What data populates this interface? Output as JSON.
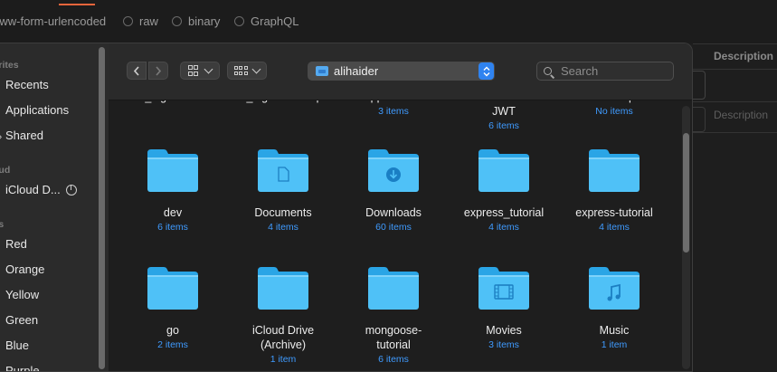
{
  "background_app": {
    "body_options": [
      {
        "label": "www-form-urlencoded",
        "radio": false
      },
      {
        "label": "raw",
        "radio": true
      },
      {
        "label": "binary",
        "radio": true
      },
      {
        "label": "GraphQL",
        "radio": true
      }
    ],
    "table_header": "Description",
    "table_placeholder": "Description",
    "accent_color": "#e8653c"
  },
  "sidebar": {
    "sections": [
      {
        "title": "orites",
        "items": [
          "Recents",
          "Applications",
          "Shared"
        ]
      },
      {
        "title": "oud",
        "items": [
          "iCloud D..."
        ]
      },
      {
        "title": "gs",
        "items": [
          "Red",
          "Orange",
          "Yellow",
          "Green",
          "Blue",
          "Purple"
        ]
      }
    ],
    "icloud_icon": "progress-circle-icon",
    "shared_icon": "chevron-right-icon"
  },
  "toolbar": {
    "back_icon": "chevron-left-icon",
    "forward_icon": "chevron-right-icon",
    "view_icon_grid": "icon-view-icon",
    "view_group": "group-view-icon",
    "location": "alihaider",
    "location_icon": "folder-icon",
    "search_placeholder": "Search"
  },
  "files": [
    {
      "name": "ali_digitalocean",
      "count": "",
      "icon": "none"
    },
    {
      "name": "ali_digitalocean.pub",
      "count": "",
      "icon": "none"
    },
    {
      "name": "Applications",
      "count": "3 items",
      "icon": "none"
    },
    {
      "name": "Authentication-JWT",
      "count": "6 items",
      "icon": "none"
    },
    {
      "name": "Desktop",
      "count": "No items",
      "icon": "none"
    },
    {
      "name": "dev",
      "count": "6 items",
      "icon": "folder-icon"
    },
    {
      "name": "Documents",
      "count": "4 items",
      "icon": "document-folder-icon"
    },
    {
      "name": "Downloads",
      "count": "60 items",
      "icon": "downloads-folder-icon"
    },
    {
      "name": "express_tutorial",
      "count": "4 items",
      "icon": "folder-icon"
    },
    {
      "name": "express-tutorial",
      "count": "4 items",
      "icon": "folder-icon"
    },
    {
      "name": "go",
      "count": "2 items",
      "icon": "folder-icon"
    },
    {
      "name": "iCloud Drive (Archive)",
      "count": "1 item",
      "icon": "folder-icon"
    },
    {
      "name": "mongoose-tutorial",
      "count": "6 items",
      "icon": "folder-icon"
    },
    {
      "name": "Movies",
      "count": "3 items",
      "icon": "movies-folder-icon"
    },
    {
      "name": "Music",
      "count": "1 item",
      "icon": "music-folder-icon"
    }
  ],
  "colors": {
    "folder_light": "#4fc1f7",
    "folder_dark": "#2aa5e6",
    "link_blue": "#3f9bff",
    "path_button": "#2f83f0"
  }
}
